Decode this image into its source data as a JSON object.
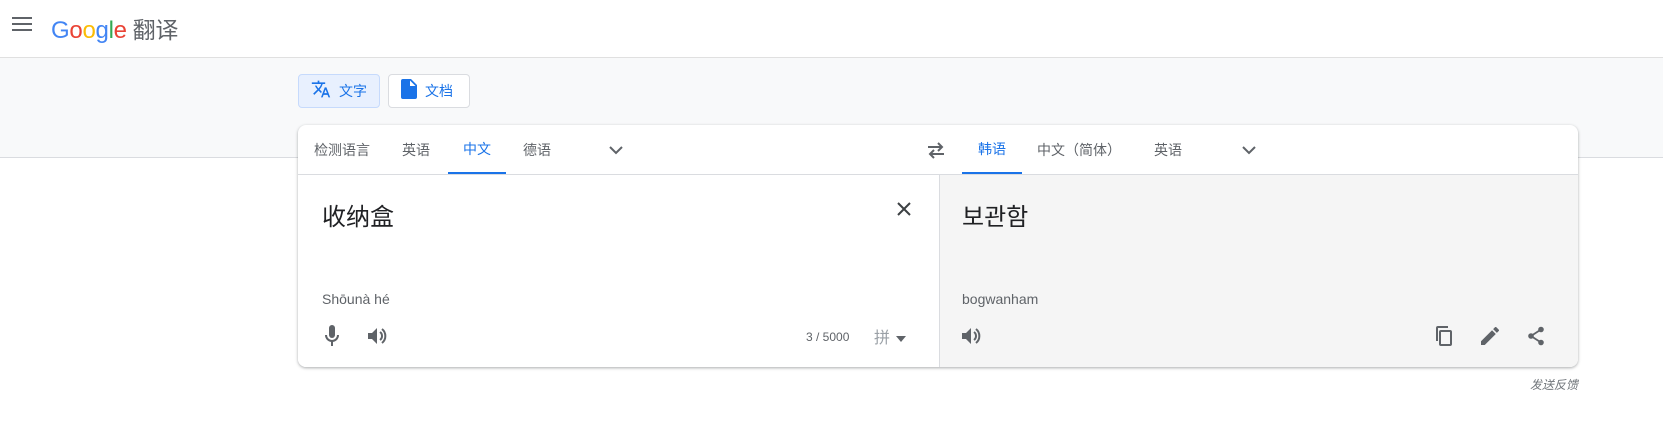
{
  "header": {
    "logo_letters": [
      "G",
      "o",
      "o",
      "g",
      "l",
      "e"
    ],
    "logo_colors": [
      "#4285f4",
      "#ea4335",
      "#fbbc05",
      "#4285f4",
      "#34a853",
      "#ea4335"
    ],
    "product_name": "翻译",
    "menu_icon": "hamburger-menu-icon"
  },
  "modes": [
    {
      "label": "文字",
      "icon": "translate-icon",
      "active": true
    },
    {
      "label": "文档",
      "icon": "document-icon",
      "active": false
    }
  ],
  "source_languages": {
    "tabs": [
      "检测语言",
      "英语",
      "中文",
      "德语"
    ],
    "selected": "中文"
  },
  "target_languages": {
    "tabs": [
      "韩语",
      "中文（简体）",
      "英语"
    ],
    "selected": "韩语"
  },
  "source": {
    "text": "收纳盒",
    "romanization": "Shōunà hé",
    "char_count": "3 / 5000",
    "ime_label": "拼"
  },
  "target": {
    "text": "보관함",
    "romanization": "bogwanham"
  },
  "footer": {
    "feedback": "发送反馈"
  },
  "colors": {
    "accent": "#1a73e8",
    "icon": "#5f6368"
  }
}
